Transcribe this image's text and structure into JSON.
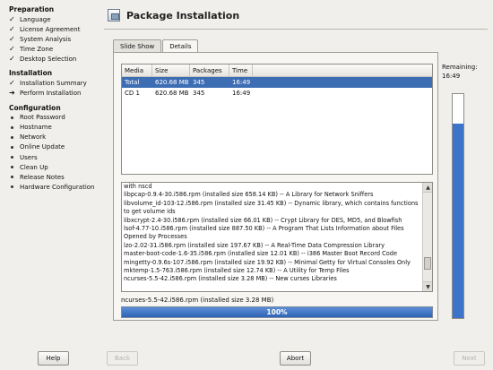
{
  "sidebar": {
    "sections": [
      {
        "title": "Preparation",
        "items": [
          {
            "label": "Language",
            "state": "done"
          },
          {
            "label": "License Agreement",
            "state": "done"
          },
          {
            "label": "System Analysis",
            "state": "done"
          },
          {
            "label": "Time Zone",
            "state": "done"
          },
          {
            "label": "Desktop Selection",
            "state": "done"
          }
        ]
      },
      {
        "title": "Installation",
        "items": [
          {
            "label": "Installation Summary",
            "state": "done"
          },
          {
            "label": "Perform Installation",
            "state": "current"
          }
        ]
      },
      {
        "title": "Configuration",
        "items": [
          {
            "label": "Root Password",
            "state": "todo"
          },
          {
            "label": "Hostname",
            "state": "todo"
          },
          {
            "label": "Network",
            "state": "todo"
          },
          {
            "label": "Online Update",
            "state": "todo"
          },
          {
            "label": "Users",
            "state": "todo"
          },
          {
            "label": "Clean Up",
            "state": "todo"
          },
          {
            "label": "Release Notes",
            "state": "todo"
          },
          {
            "label": "Hardware Configuration",
            "state": "todo"
          }
        ]
      }
    ]
  },
  "main": {
    "title": "Package Installation",
    "title_icon": "package-installer-icon",
    "tabs": [
      {
        "label": "Slide Show",
        "active": false
      },
      {
        "label": "Details",
        "active": true
      }
    ],
    "media_table": {
      "headers": [
        "Media",
        "Size",
        "Packages",
        "Time"
      ],
      "rows": [
        {
          "media": "Total",
          "size": "620.68 MB",
          "packages": "345",
          "time": "16:49",
          "selected": true
        },
        {
          "media": "CD 1",
          "size": "620.68 MB",
          "packages": "345",
          "time": "16:49",
          "selected": false
        }
      ]
    },
    "log_lines": [
      "with nscd",
      "libpcap-0.9.4-30.i586.rpm (installed size 658.14 KB) -- A Library for Network Sniffers",
      "libvolume_id-103-12.i586.rpm (installed size 31.45 KB) -- Dynamic library, which contains functions",
      "to get volume ids",
      "libxcrypt-2.4-30.i586.rpm (installed size 66.01 KB) -- Crypt Library for DES, MD5, and Blowfish",
      "lsof-4.77-10.i586.rpm (installed size 887.50 KB) -- A Program That Lists Information about Files",
      "Opened by Processes",
      "lzo-2.02-31.i586.rpm (installed size 197.67 KB) -- A Real-Time Data Compression Library",
      "master-boot-code-1.6-35.i586.rpm (installed size 12.01 KB) -- i386 Master Boot Record Code",
      "mingetty-0.9.6s-107.i586.rpm (installed size 19.92 KB) -- Minimal Getty for Virtual Consoles Only",
      "mktemp-1.5-763.i586.rpm (installed size 12.74 KB) -- A Utility for Temp Files",
      "ncurses-5.5-42.i586.rpm (installed size 3.28 MB) -- New curses Libraries"
    ],
    "current_file": "ncurses-5.5-42.i586.rpm (installed size 3.28 MB)",
    "progress": {
      "percent": 100,
      "label": "100%"
    },
    "remaining": {
      "label": "Remaining:",
      "time": "16:49",
      "fraction": 0.87
    },
    "colors": {
      "accent": "#3d6db3",
      "progress": "#2f64b6"
    }
  },
  "buttons": {
    "help": "Help",
    "back": "Back",
    "abort": "Abort",
    "next": "Next"
  }
}
